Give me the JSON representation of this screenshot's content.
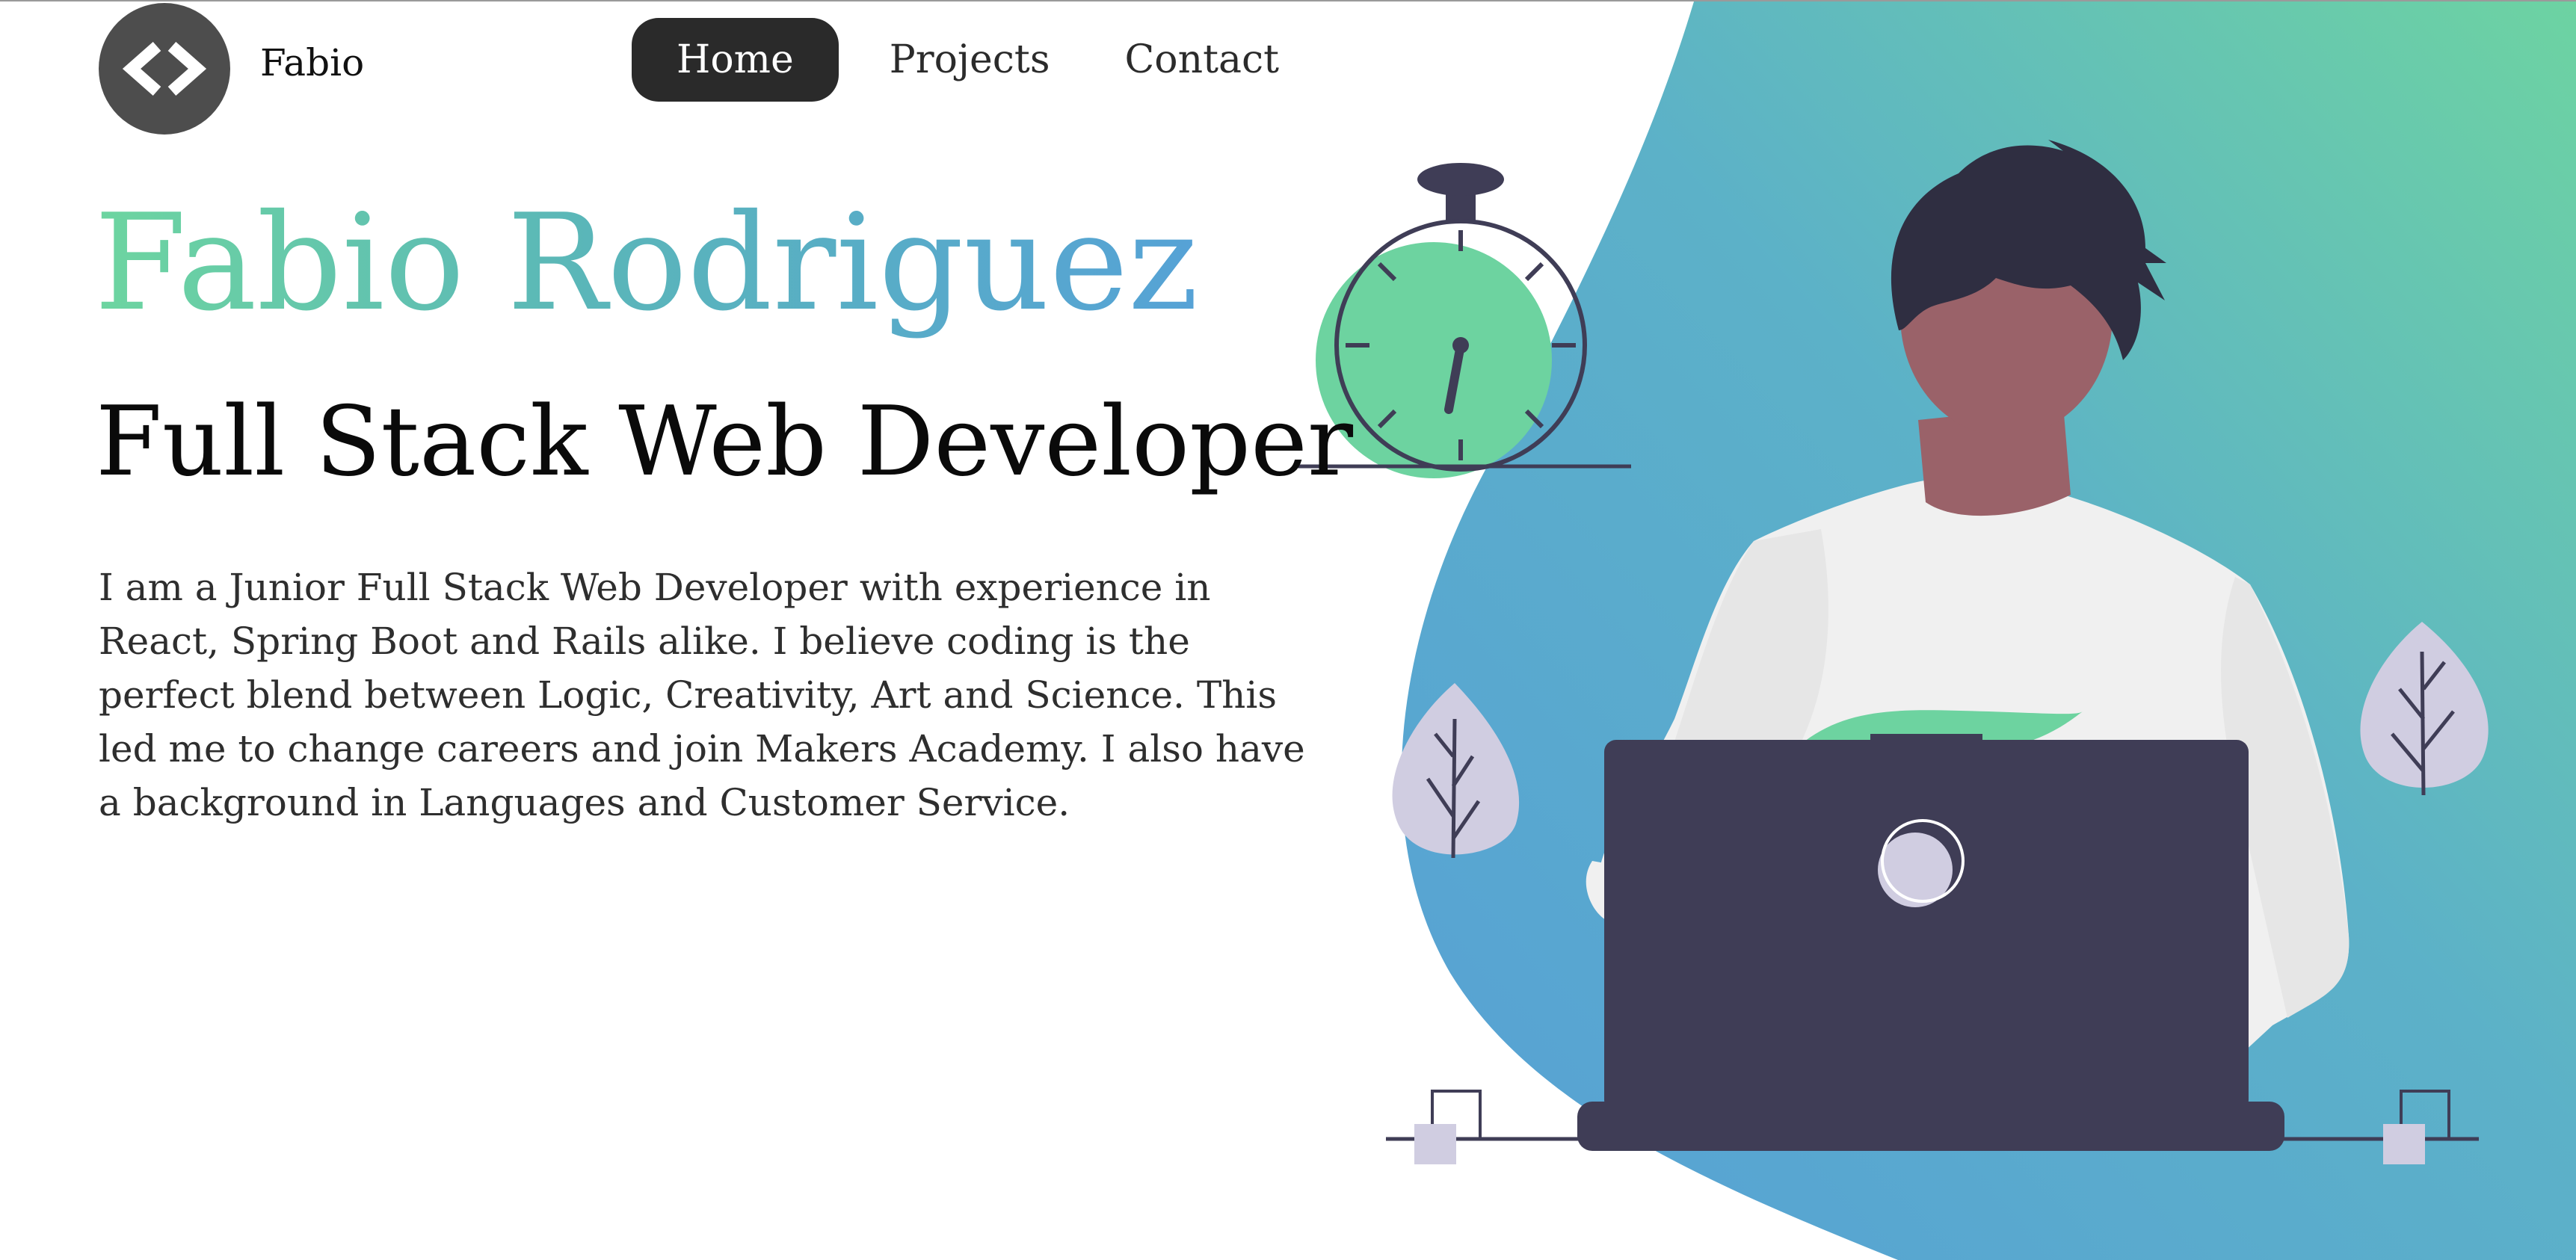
{
  "brand": {
    "name": "Fabio",
    "logo_icon": "code-brackets-icon"
  },
  "nav": {
    "items": [
      {
        "label": "Home",
        "active": true
      },
      {
        "label": "Projects",
        "active": false
      },
      {
        "label": "Contact",
        "active": false
      }
    ]
  },
  "hero": {
    "name": "Fabio Rodriguez",
    "role": "Full Stack Web Developer",
    "bio": "I am a Junior Full Stack Web Developer with experience in React, Spring Boot and Rails alike. I believe coding is the perfect blend between Logic, Creativity, Art and Science. This led me to change careers and join Makers Academy. I also have a background in Languages and Customer Service."
  },
  "illustration": {
    "subject": "developer-at-laptop-illustration",
    "icons": [
      "stopwatch-icon",
      "plant-leaf-icon",
      "laptop-icon",
      "person-icon"
    ]
  },
  "colors": {
    "accent_green": "#6dd5a0",
    "accent_blue": "#56a2d6",
    "nav_active_bg": "#2a2a2a",
    "logo_bg": "#4d4d4d",
    "dark_navy": "#3f3d56",
    "hair": "#2f2e41",
    "skin": "#9a6269",
    "shirt": "#f0f0f0",
    "leaf": "#d0cde1"
  }
}
